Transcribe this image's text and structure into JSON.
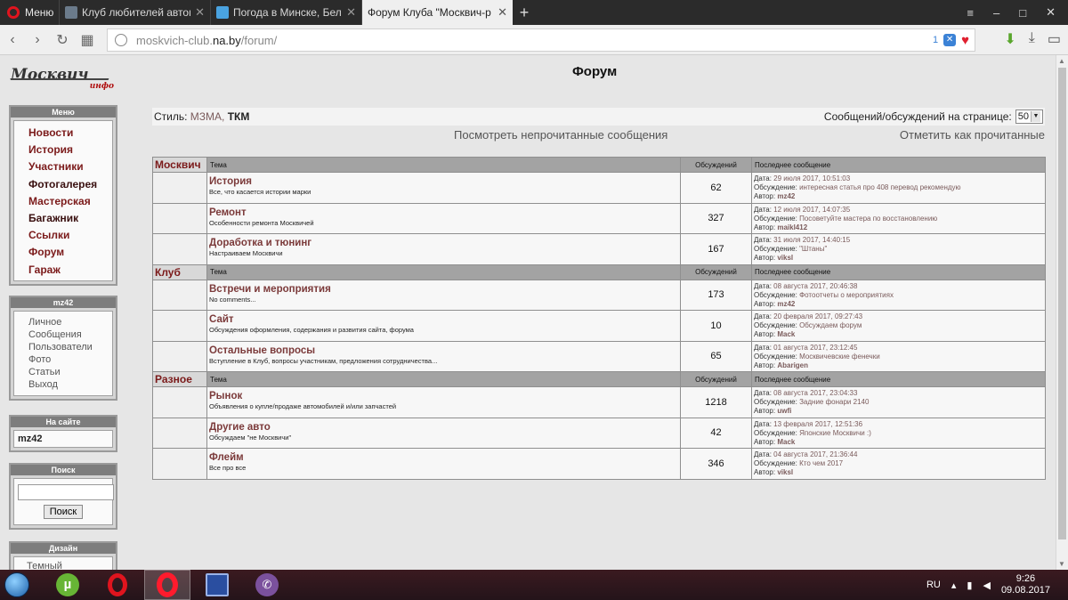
{
  "browser": {
    "menu_label": "Меню",
    "tabs": [
      {
        "title": "Клуб любителей автомоб",
        "active": false
      },
      {
        "title": "Погода в Минске, Белару",
        "active": false
      },
      {
        "title": "Форум Клуба \"Москвич-р",
        "active": true
      }
    ],
    "new_tab": "+",
    "url_prefix": "moskvich-club.",
    "url_host": "na.by",
    "url_path": "/forum/",
    "badge_count": "1"
  },
  "page": {
    "title": "Форум",
    "logo_text": "Москвич",
    "logo_sub": "инфо"
  },
  "menu_panel": {
    "header": "Меню",
    "items": [
      "Новости",
      "История",
      "Участники",
      "Фотогалерея",
      "Мастерская",
      "Багажник",
      "Ссылки",
      "Форум",
      "Гараж"
    ]
  },
  "user_panel": {
    "header": "mz42",
    "items": [
      "Личное",
      "Сообщения",
      "Пользователи",
      "Фото",
      "Статьи",
      "Выход"
    ]
  },
  "online_panel": {
    "header": "На сайте",
    "user": "mz42"
  },
  "search_panel": {
    "header": "Поиск",
    "button": "Поиск",
    "value": ""
  },
  "design_panel": {
    "header": "Дизайн",
    "item": "Темный"
  },
  "stylebar": {
    "label": "Стиль:",
    "style1": "МЗМА,",
    "style2": "ТКМ",
    "per_page_label": "Сообщений/обсуждений на странице:",
    "per_page_value": "50"
  },
  "actions": {
    "unread": "Посмотреть непрочитанные сообщения",
    "mark_read": "Отметить как прочитанные"
  },
  "table_headers": {
    "topic": "Тема",
    "count": "Обсуждений",
    "last": "Последнее сообщение"
  },
  "last_labels": {
    "date": "Дата:",
    "discussion": "Обсуждение:",
    "author": "Автор:"
  },
  "forum": [
    {
      "category": "Москвич",
      "rows": [
        {
          "name": "История",
          "desc": "Все, что касается истории марки",
          "count": "62",
          "date": "29 июля 2017, 10:51:03",
          "discussion": "интересная статья про 408 перевод рекомендую",
          "author": "mz42"
        },
        {
          "name": "Ремонт",
          "desc": "Особенности ремонта Москвичей",
          "count": "327",
          "date": "12 июля 2017, 14:07:35",
          "discussion": "Посоветуйте мастера по восстановлению",
          "author": "maikl412"
        },
        {
          "name": "Доработка и тюнинг",
          "desc": "Настраиваем Москвичи",
          "count": "167",
          "date": "31 июля 2017, 14:40:15",
          "discussion": "\"Штаны\"",
          "author": "viksl"
        }
      ]
    },
    {
      "category": "Клуб",
      "rows": [
        {
          "name": "Встречи и мероприятия",
          "desc": "No comments...",
          "count": "173",
          "date": "08 августа 2017, 20:46:38",
          "discussion": "Фотоотчеты о мероприятиях",
          "author": "mz42"
        },
        {
          "name": "Сайт",
          "desc": "Обсуждения оформления, содержания и развития сайта, форума",
          "count": "10",
          "date": "20 февраля 2017, 09:27:43",
          "discussion": "Обсуждаем форум",
          "author": "Mack"
        },
        {
          "name": "Остальные вопросы",
          "desc": "Вступление в Клуб, вопросы участникам, предложения сотрудничества...",
          "count": "65",
          "date": "01 августа 2017, 23:12:45",
          "discussion": "Москвичевские фенечки",
          "author": "Abarigen"
        }
      ]
    },
    {
      "category": "Разное",
      "rows": [
        {
          "name": "Рынок",
          "desc": "Объявления о купле/продаже автомобилей и/или запчастей",
          "count": "1218",
          "date": "08 августа 2017, 23:04:33",
          "discussion": "Задние фонари 2140",
          "author": "uwfi"
        },
        {
          "name": "Другие авто",
          "desc": "Обсуждаем \"не Москвичи\"",
          "count": "42",
          "date": "13 февраля 2017, 12:51:36",
          "discussion": "Японские Москвичи :)",
          "author": "Mack"
        },
        {
          "name": "Флейм",
          "desc": "Все про все",
          "count": "346",
          "date": "04 августа 2017, 21:36:44",
          "discussion": "Кто чем 2017",
          "author": "viksl"
        }
      ]
    }
  ],
  "taskbar": {
    "lang": "RU",
    "time": "9:26",
    "date": "09.08.2017"
  },
  "icons": [
    "opera-icon",
    "back-icon",
    "forward-icon",
    "reload-icon",
    "speed-dial-icon",
    "globe-icon",
    "heart-icon",
    "download-icon",
    "battery-icon",
    "windows-start-icon",
    "utorrent-icon",
    "floppy-icon",
    "viber-icon"
  ]
}
